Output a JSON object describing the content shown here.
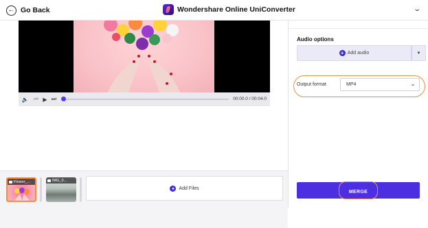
{
  "header": {
    "back_label": "Go Back",
    "brand_name": "Wondershare Online UniConverter",
    "back_icon": "arrow-left-circle-icon",
    "menu_icon": "chevron-down-icon"
  },
  "player": {
    "time_display": "00:00.0 / 00:04.0",
    "progress": 0.0
  },
  "timeline": {
    "clips": [
      {
        "label": "Flower_...",
        "selected": true
      },
      {
        "label": "IMG_0...",
        "selected": false
      }
    ],
    "add_files_label": "Add Files"
  },
  "sidebar": {
    "audio_title": "Audio options",
    "add_audio_label": "Add audio",
    "output_format_label": "Output format",
    "output_format_value": "MP4",
    "merge_label": "MERGE"
  },
  "colors": {
    "accent": "#4b2fe0",
    "highlight": "#e59044",
    "progress_dot": "#4b3cff"
  }
}
